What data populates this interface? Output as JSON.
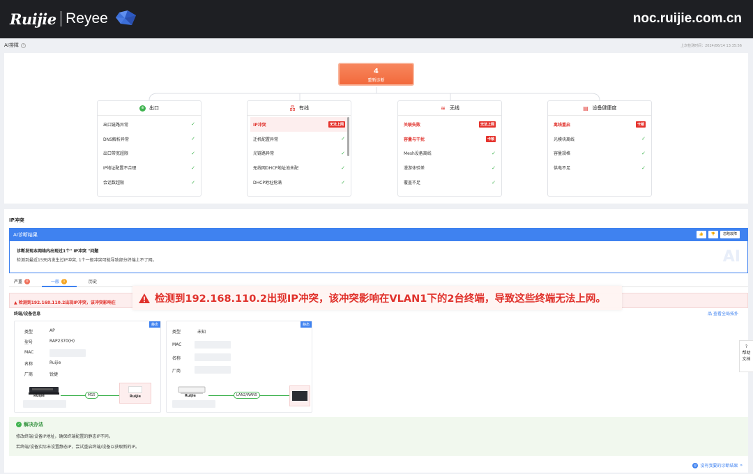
{
  "header": {
    "brand_left": "Ruijie",
    "brand_right": "Reyee",
    "domain": "noc.ruijie.com.cn"
  },
  "page": {
    "title": "AI排障",
    "last_time": "上次检测时间：2024/06/14 13:35:56"
  },
  "diagnosis": {
    "count": "4",
    "label": "重新诊断"
  },
  "categories": [
    {
      "name": "出口",
      "items": [
        {
          "label": "出口链路异常",
          "status": "ok"
        },
        {
          "label": "DNS解析异常",
          "status": "ok"
        },
        {
          "label": "出口带宽超限",
          "status": "ok"
        },
        {
          "label": "IP地址配置不合理",
          "status": "ok"
        },
        {
          "label": "会话数超限",
          "status": "ok"
        }
      ]
    },
    {
      "name": "有线",
      "items": [
        {
          "label": "IP冲突",
          "status": "bad",
          "tag": "无法上网"
        },
        {
          "label": "迁机配置异常",
          "status": "ok"
        },
        {
          "label": "光链路异常",
          "status": "ok"
        },
        {
          "label": "无线网DHCP地址池未配",
          "status": "ok"
        },
        {
          "label": "DHCP地址抢满",
          "status": "ok"
        }
      ]
    },
    {
      "name": "无线",
      "items": [
        {
          "label": "关联失败",
          "status": "bad",
          "tag": "无法上网"
        },
        {
          "label": "容量与干扰",
          "status": "bad",
          "tag": "卡顿"
        },
        {
          "label": "Mesh设备离线",
          "status": "ok"
        },
        {
          "label": "漫游体验差",
          "status": "ok"
        },
        {
          "label": "覆盖不足",
          "status": "ok"
        }
      ]
    },
    {
      "name": "设备健康度",
      "items": [
        {
          "label": "离线重启",
          "status": "bad",
          "tag": "卡顿"
        },
        {
          "label": "光模块离线",
          "status": "ok"
        },
        {
          "label": "容量规格",
          "status": "ok"
        },
        {
          "label": "供电不足",
          "status": "ok"
        }
      ]
    }
  ],
  "detail": {
    "section_title": "IP冲突",
    "ai_title": "AI诊断结果",
    "ai_buttons": [
      "👍",
      "👎",
      "忽略故障"
    ],
    "ai_line1": "诊断发现本网络内出现过1个\" IP冲突 \"问题",
    "ai_line2": "检测到最近15天内发生过IP冲突, 1个一般冲突可能导致部分终端上不了网。",
    "ai_watermark": "AI",
    "tabs": [
      {
        "label": "严重",
        "badge": "0"
      },
      {
        "label": "一般",
        "badge": "1"
      },
      {
        "label": "历史",
        "badge": ""
      }
    ],
    "alert": "检测到192.168.110.2出现IP冲突，该冲突影响在",
    "devices_title": "终端/设备信息",
    "topology_link": "查看全局拓扑",
    "device1": {
      "tag": "静态",
      "type_k": "类型",
      "type_v": "AP",
      "model_k": "型号",
      "model_v": "RAP2370(H)",
      "mac_k": "MAC",
      "name_k": "名称",
      "name_v": "Ruijie",
      "vendor_k": "厂商",
      "vendor_v": "锐捷",
      "left_label": "Ruijie",
      "port": "M15",
      "right_label": "Ruijie"
    },
    "device2": {
      "tag": "静态",
      "type_k": "类型",
      "type_v": "未知",
      "mac_k": "MAC",
      "name_k": "名称",
      "vendor_k": "厂商",
      "left_label": "Ruijie",
      "port": "LAN2/WAN5"
    },
    "solution_title": "解决办法",
    "solution_line1": "修改终端/设备IP地址，确保终端配置的静态IP不同。",
    "solution_line2": "若终端/设备实际未设置静态IP，尝试重启终端/设备以获取新的IP。",
    "no_result": "没有我要的诊断结果"
  },
  "overlay": {
    "text": "检测到192.168.110.2出现IP冲突，该冲突影响在VLAN1下的2台终端，导致这些终端无法上网。"
  },
  "help_float": {
    "line1": "帮助",
    "line2": "文档"
  },
  "colors": {
    "accent": "#3f82f0",
    "danger": "#e0322c",
    "ok": "#3fb34f",
    "diag": "#f26a3c"
  }
}
